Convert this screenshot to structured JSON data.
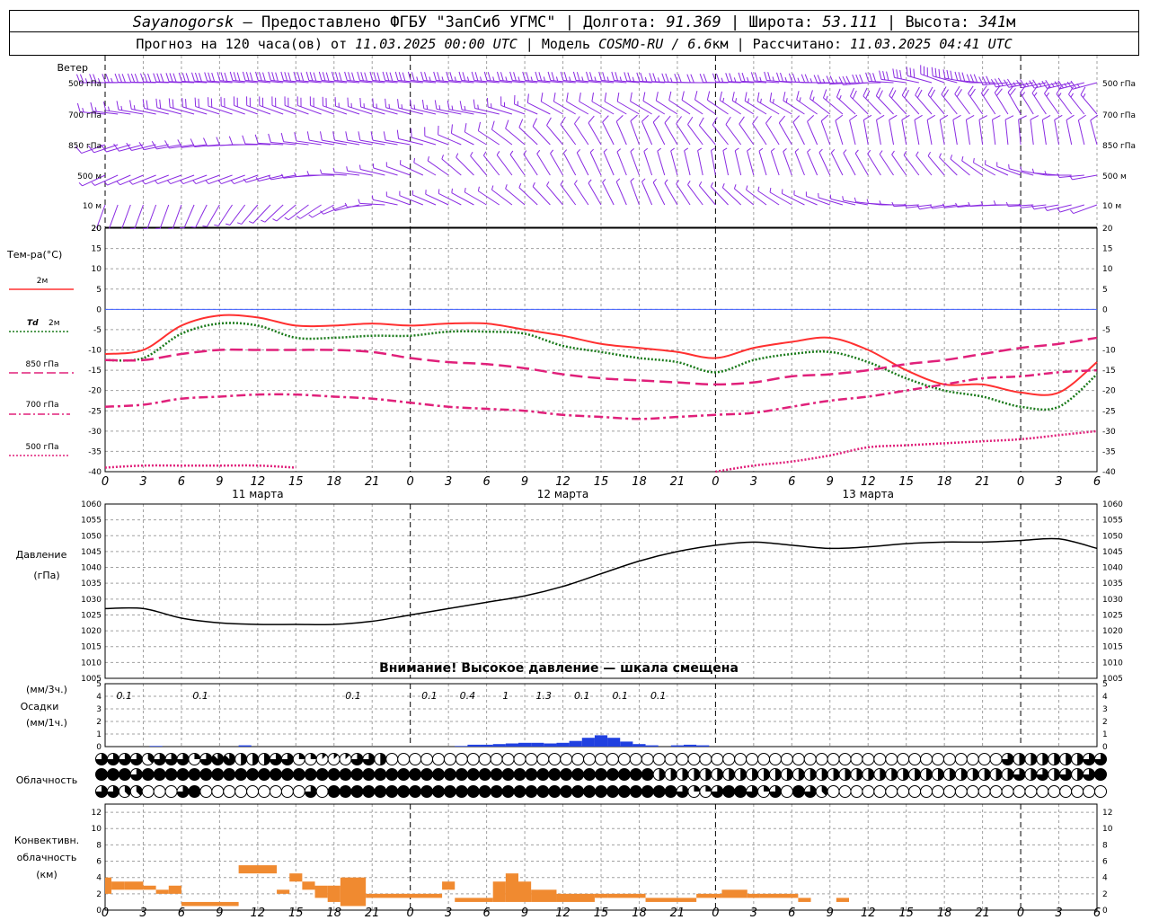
{
  "header": {
    "line1": [
      {
        "text": "Sayanogorsk",
        "italic": true
      },
      {
        "text": " — Предоставлено ФГБУ \"ЗапСиб УГМС\" | Долгота: ",
        "italic": false
      },
      {
        "text": "91.369",
        "italic": true
      },
      {
        "text": " | Широта: ",
        "italic": false
      },
      {
        "text": "53.111",
        "italic": true
      },
      {
        "text": " | Высота: ",
        "italic": false
      },
      {
        "text": "341",
        "italic": true
      },
      {
        "text": "м",
        "italic": false
      }
    ],
    "line2": [
      {
        "text": "Прогноз на 120 часа(ов) от ",
        "italic": false
      },
      {
        "text": "11.03.2025 00:00 UTC",
        "italic": true
      },
      {
        "text": " | Модель ",
        "italic": false
      },
      {
        "text": "COSMO-RU / 6.6",
        "italic": true
      },
      {
        "text": "км | Рассчитано: ",
        "italic": false
      },
      {
        "text": "11.03.2025 04:41 UTC",
        "italic": true
      }
    ]
  },
  "colors": {
    "wind": "#8a2be2",
    "t2m": "#ff3030",
    "td2m": "#1a7a1a",
    "t850": "#e0207a",
    "t700": "#e0207a",
    "t500": "#e0207a",
    "pressure": "#000000",
    "precip": "#2040e0",
    "convective": "#f08a30",
    "zero_line": "#4060ff",
    "grid": "#a0a0a0"
  },
  "x_axis": {
    "hour_labels": [
      "0",
      "3",
      "6",
      "9",
      "12",
      "15",
      "18",
      "21",
      "0",
      "3",
      "6",
      "9",
      "12",
      "15",
      "18",
      "21",
      "0",
      "3",
      "6",
      "9",
      "12",
      "15",
      "18",
      "21",
      "0",
      "3",
      "6"
    ],
    "date_labels": [
      {
        "text": "11 марта",
        "hour": 12
      },
      {
        "text": "12 марта",
        "hour": 36
      },
      {
        "text": "13 марта",
        "hour": 60
      }
    ]
  },
  "chart_data": [
    {
      "type": "barbs",
      "panel": "wind",
      "title": "Ветер",
      "levels": [
        "500 гПа",
        "700 гПа",
        "850 гПа",
        "500 м",
        "10 м"
      ],
      "x_hours": [
        0,
        6,
        12,
        18,
        24,
        30,
        36,
        42,
        48,
        54,
        60,
        66,
        72,
        78
      ],
      "wind_from_direction_deg": [
        [
          270,
          272,
          275,
          275,
          275,
          275,
          275,
          275,
          270,
          275,
          265,
          290,
          260,
          255
        ],
        [
          275,
          285,
          290,
          290,
          285,
          280,
          300,
          300,
          305,
          300,
          315,
          320,
          330,
          320
        ],
        [
          250,
          260,
          270,
          280,
          280,
          300,
          320,
          340,
          320,
          330,
          350,
          350,
          355,
          345
        ],
        [
          245,
          250,
          250,
          270,
          290,
          320,
          330,
          340,
          350,
          340,
          330,
          320,
          290,
          260
        ],
        [
          200,
          200,
          220,
          240,
          290,
          300,
          320,
          340,
          320,
          300,
          280,
          260,
          270,
          250
        ]
      ],
      "wind_speed_ms": [
        [
          25,
          30,
          32,
          30,
          28,
          26,
          24,
          24,
          22,
          24,
          28,
          32,
          28,
          24
        ],
        [
          15,
          18,
          20,
          18,
          16,
          14,
          12,
          12,
          12,
          14,
          18,
          20,
          18,
          14
        ],
        [
          8,
          10,
          12,
          10,
          8,
          8,
          8,
          8,
          8,
          10,
          10,
          12,
          10,
          8
        ],
        [
          5,
          5,
          6,
          6,
          6,
          6,
          5,
          5,
          5,
          6,
          6,
          6,
          6,
          5
        ],
        [
          2,
          3,
          3,
          3,
          3,
          3,
          3,
          3,
          3,
          3,
          3,
          3,
          3,
          3
        ]
      ]
    },
    {
      "type": "line",
      "panel": "temperature",
      "title": "Тем-ра(°С)",
      "ylim": [
        -40,
        20
      ],
      "y_ticks": [
        20,
        15,
        10,
        5,
        0,
        -5,
        -10,
        -15,
        -20,
        -25,
        -30,
        -35,
        -40
      ],
      "x_hours": [
        0,
        3,
        6,
        9,
        12,
        15,
        18,
        21,
        24,
        27,
        30,
        33,
        36,
        39,
        42,
        45,
        48,
        51,
        54,
        57,
        60,
        63,
        66,
        69,
        72,
        75,
        78
      ],
      "series": [
        {
          "name": "2м",
          "key": "t2m",
          "dash": "solid",
          "values": [
            -11,
            -10,
            -4,
            -1.5,
            -2,
            -4,
            -4,
            -3.5,
            -4,
            -3.5,
            -3.5,
            -5,
            -6.5,
            -8.5,
            -9.5,
            -10.5,
            -12,
            -9.5,
            -8,
            -7,
            -10,
            -15,
            -18.5,
            -18.5,
            -20.5,
            -20.5,
            -13
          ]
        },
        {
          "name": "Td 2м",
          "key": "td2m",
          "dash": "dotted",
          "values": [
            -12.5,
            -12,
            -6,
            -3.5,
            -4,
            -7,
            -7,
            -6.5,
            -6.5,
            -5.5,
            -5.5,
            -6,
            -9,
            -10.5,
            -12,
            -13,
            -15.5,
            -12.5,
            -11,
            -10.5,
            -13,
            -17,
            -20,
            -21.5,
            -24,
            -24,
            -16
          ]
        },
        {
          "name": "850 гПа",
          "key": "t850",
          "dash": "longdash",
          "values": [
            -12.5,
            -12.5,
            -11,
            -10,
            -10,
            -10,
            -10,
            -10.5,
            -12,
            -13,
            -13.5,
            -14.5,
            -16,
            -17,
            -17.5,
            -18,
            -18.5,
            -18,
            -16.5,
            -16,
            -15,
            -13.5,
            -12.5,
            -11,
            -9.5,
            -8.5,
            -7
          ]
        },
        {
          "name": "700 гПа",
          "key": "t700",
          "dash": "dashdot",
          "values": [
            -24,
            -23.5,
            -22,
            -21.5,
            -21,
            -21,
            -21.5,
            -22,
            -23,
            -24,
            -24.5,
            -25,
            -26,
            -26.5,
            -27,
            -26.5,
            -26,
            -25.5,
            -24,
            -22.5,
            -21.5,
            -20,
            -18.5,
            -17,
            -16.5,
            -15.5,
            -15
          ]
        },
        {
          "name": "500 гПа",
          "key": "t500",
          "dash": "dotted",
          "values": [
            -39,
            -38.5,
            -38.5,
            -38.5,
            -38.5,
            -39,
            null,
            null,
            null,
            null,
            null,
            null,
            null,
            null,
            null,
            null,
            -40,
            -38.5,
            -37.5,
            -36,
            -34,
            -33.5,
            -33,
            -32.5,
            -32,
            -31,
            -30
          ]
        }
      ]
    },
    {
      "type": "line",
      "panel": "pressure",
      "title": "Давление (гПа)",
      "ylim": [
        1005,
        1060
      ],
      "y_ticks": [
        1060,
        1055,
        1050,
        1045,
        1040,
        1035,
        1030,
        1025,
        1020,
        1015,
        1010,
        1005
      ],
      "x_hours": [
        0,
        3,
        6,
        9,
        12,
        15,
        18,
        21,
        24,
        27,
        30,
        33,
        36,
        39,
        42,
        45,
        48,
        51,
        54,
        57,
        60,
        63,
        66,
        69,
        72,
        75,
        78
      ],
      "series": [
        {
          "name": "",
          "key": "pressure",
          "values": [
            1027,
            1027,
            1024,
            1022.5,
            1022,
            1022,
            1022,
            1023,
            1025,
            1027,
            1029,
            1031,
            1034,
            1038,
            1042,
            1045,
            1047,
            1048,
            1047,
            1046,
            1046.5,
            1047.5,
            1048,
            1048,
            1048.5,
            1049,
            1046
          ]
        }
      ],
      "annotation": "Внимание! Высокое давление — шкала смещена"
    },
    {
      "type": "bar",
      "panel": "precipitation",
      "title": "(мм/3ч.) Осадки (мм/1ч.)",
      "ylim": [
        0,
        5
      ],
      "y_ticks": [
        5,
        4,
        3,
        2,
        1,
        0
      ],
      "x_hours": [
        0,
        1,
        2,
        3,
        4,
        5,
        6,
        7,
        8,
        9,
        10,
        11,
        12,
        13,
        14,
        15,
        16,
        17,
        18,
        19,
        20,
        21,
        22,
        23,
        24,
        25,
        26,
        27,
        28,
        29,
        30,
        31,
        32,
        33,
        34,
        35,
        36,
        37,
        38,
        39,
        40,
        41,
        42,
        43,
        44,
        45,
        46,
        47
      ],
      "values_mm_1h": [
        0,
        0,
        0,
        0,
        0.05,
        0,
        0,
        0,
        0,
        0,
        0,
        0.1,
        0,
        0,
        0,
        0,
        0,
        0,
        0,
        0,
        0,
        0,
        0,
        0,
        0,
        0,
        0,
        0,
        0.05,
        0.15,
        0.15,
        0.2,
        0.25,
        0.3,
        0.3,
        0.25,
        0.3,
        0.45,
        0.7,
        0.9,
        0.7,
        0.4,
        0.2,
        0.1,
        0,
        0.1,
        0.15,
        0.1
      ],
      "labels_3h": [
        {
          "hour": 1.5,
          "text": "0.1"
        },
        {
          "hour": 7.5,
          "text": "0.1"
        },
        {
          "hour": 19.5,
          "text": "0.1"
        },
        {
          "hour": 25.5,
          "text": "0.1"
        },
        {
          "hour": 28.5,
          "text": "0.4"
        },
        {
          "hour": 31.5,
          "text": "1"
        },
        {
          "hour": 34.5,
          "text": "1.3"
        },
        {
          "hour": 37.5,
          "text": "0.1"
        },
        {
          "hour": 40.5,
          "text": "0.1"
        },
        {
          "hour": 43.5,
          "text": "0.1"
        }
      ]
    },
    {
      "type": "table",
      "panel": "cloudiness",
      "title": "Облачность",
      "rows_note": "cloud cover octa-circles, 0 = clear, 8 = overcast; three layers top to bottom",
      "values_octas": [
        [
          6,
          6,
          6,
          6,
          3,
          6,
          6,
          6,
          2,
          6,
          7,
          7,
          4,
          4,
          4,
          6,
          6,
          2,
          2,
          1,
          1,
          1,
          6,
          6,
          4,
          0,
          0,
          0,
          0,
          0,
          0,
          0,
          0,
          0,
          0,
          0,
          0,
          0,
          0,
          0,
          0,
          0,
          0,
          0,
          0,
          0,
          0,
          0,
          0,
          0,
          0,
          0,
          0,
          0,
          0,
          0,
          0,
          0,
          0,
          0,
          0,
          0,
          0,
          0,
          0,
          0,
          0,
          0,
          0,
          0,
          0,
          0,
          0,
          0,
          0,
          0,
          0,
          0,
          6,
          4,
          4,
          4,
          4,
          4,
          4,
          6,
          6
        ],
        [
          8,
          8,
          8,
          6,
          8,
          8,
          8,
          8,
          8,
          8,
          8,
          8,
          8,
          8,
          8,
          8,
          8,
          8,
          8,
          8,
          8,
          8,
          8,
          8,
          8,
          8,
          8,
          8,
          8,
          8,
          8,
          8,
          8,
          8,
          8,
          8,
          8,
          8,
          8,
          8,
          8,
          8,
          8,
          8,
          8,
          8,
          8,
          8,
          4,
          4,
          4,
          4,
          4,
          4,
          4,
          4,
          4,
          4,
          4,
          4,
          4,
          4,
          4,
          4,
          4,
          4,
          4,
          4,
          4,
          4,
          4,
          4,
          4,
          4,
          4,
          4,
          4,
          4,
          4,
          6,
          4,
          6,
          4,
          6,
          4,
          6,
          8
        ],
        [
          6,
          6,
          3,
          3,
          0,
          0,
          0,
          6,
          8,
          0,
          0,
          0,
          0,
          0,
          0,
          0,
          0,
          0,
          6,
          0,
          8,
          8,
          8,
          8,
          8,
          8,
          8,
          8,
          8,
          8,
          8,
          8,
          8,
          8,
          8,
          8,
          8,
          8,
          8,
          8,
          8,
          8,
          8,
          8,
          8,
          8,
          8,
          8,
          8,
          8,
          6,
          2,
          2,
          6,
          8,
          8,
          6,
          2,
          6,
          0,
          8,
          6,
          3,
          0,
          0,
          0,
          0,
          0,
          0,
          0,
          0,
          0,
          0,
          0,
          0,
          0,
          0,
          0,
          0,
          0,
          0,
          0,
          0,
          0,
          0,
          0,
          0
        ]
      ]
    },
    {
      "type": "bar",
      "panel": "convective",
      "title": "Конвективн. облачность (км)",
      "ylim": [
        0,
        13
      ],
      "y_ticks": [
        12,
        10,
        8,
        6,
        4,
        2,
        0
      ],
      "bars": [
        {
          "h0": 0,
          "h1": 0.5,
          "lo": 2,
          "hi": 4
        },
        {
          "h0": 0.5,
          "h1": 1.5,
          "lo": 2.5,
          "hi": 3.5
        },
        {
          "h0": 1.5,
          "h1": 3,
          "lo": 2.5,
          "hi": 3.5
        },
        {
          "h0": 3,
          "h1": 4,
          "lo": 2.5,
          "hi": 3
        },
        {
          "h0": 4,
          "h1": 5,
          "lo": 2,
          "hi": 2.5
        },
        {
          "h0": 5,
          "h1": 6,
          "lo": 2,
          "hi": 3
        },
        {
          "h0": 6,
          "h1": 10.5,
          "lo": 0.5,
          "hi": 1
        },
        {
          "h0": 10.5,
          "h1": 13.5,
          "lo": 4.5,
          "hi": 5.5
        },
        {
          "h0": 13.5,
          "h1": 14.5,
          "lo": 2,
          "hi": 2.5
        },
        {
          "h0": 14.5,
          "h1": 15.5,
          "lo": 3.5,
          "hi": 4.5
        },
        {
          "h0": 15.5,
          "h1": 16.5,
          "lo": 2.5,
          "hi": 3.5
        },
        {
          "h0": 16.5,
          "h1": 17.5,
          "lo": 1.5,
          "hi": 3
        },
        {
          "h0": 17.5,
          "h1": 18.5,
          "lo": 1,
          "hi": 3
        },
        {
          "h0": 18.5,
          "h1": 20.5,
          "lo": 0.5,
          "hi": 4
        },
        {
          "h0": 20.5,
          "h1": 26.5,
          "lo": 1.5,
          "hi": 2
        },
        {
          "h0": 26.5,
          "h1": 27.5,
          "lo": 2.5,
          "hi": 3.5
        },
        {
          "h0": 27.5,
          "h1": 30.5,
          "lo": 1,
          "hi": 1.5
        },
        {
          "h0": 30.5,
          "h1": 31.5,
          "lo": 1,
          "hi": 3.5
        },
        {
          "h0": 31.5,
          "h1": 32.5,
          "lo": 1,
          "hi": 4.5
        },
        {
          "h0": 32.5,
          "h1": 33.5,
          "lo": 1,
          "hi": 3.5
        },
        {
          "h0": 33.5,
          "h1": 35.5,
          "lo": 1,
          "hi": 2.5
        },
        {
          "h0": 35.5,
          "h1": 38.5,
          "lo": 1,
          "hi": 2
        },
        {
          "h0": 38.5,
          "h1": 39.5,
          "lo": 1.5,
          "hi": 2
        },
        {
          "h0": 39.5,
          "h1": 42.5,
          "lo": 1.5,
          "hi": 2
        },
        {
          "h0": 42.5,
          "h1": 46.5,
          "lo": 1,
          "hi": 1.5
        },
        {
          "h0": 46.5,
          "h1": 48.5,
          "lo": 1.5,
          "hi": 2
        },
        {
          "h0": 48.5,
          "h1": 50.5,
          "lo": 1.5,
          "hi": 2.5
        },
        {
          "h0": 50.5,
          "h1": 51.5,
          "lo": 1.5,
          "hi": 2
        },
        {
          "h0": 51.5,
          "h1": 54.5,
          "lo": 1.5,
          "hi": 2
        },
        {
          "h0": 54.5,
          "h1": 55.5,
          "lo": 1,
          "hi": 1.5
        },
        {
          "h0": 57.5,
          "h1": 58.5,
          "lo": 1,
          "hi": 1.5
        }
      ]
    }
  ],
  "labels": {
    "wind_title": "Ветер",
    "wind_levels": [
      "500 гПа",
      "700 гПа",
      "850 гПа",
      "500 м",
      "10 м"
    ],
    "temp_title": "Тем-ра(°С)",
    "legend_t2m": "2м",
    "legend_td_prefix": "Td",
    "legend_td": "2м",
    "legend_850": "850 гПа",
    "legend_700": "700 гПа",
    "legend_500": "500 гПа",
    "pressure_title1": "Давление",
    "pressure_title2": "(гПа)",
    "precip_title1": "(мм/3ч.)",
    "precip_title2": "Осадки",
    "precip_title3": "(мм/1ч.)",
    "cloud_title": "Облачность",
    "conv_title1": "Конвективн.",
    "conv_title2": "облачность",
    "conv_title3": "(км)",
    "pressure_warning": "Внимание! Высокое давление — шкала смещена"
  }
}
